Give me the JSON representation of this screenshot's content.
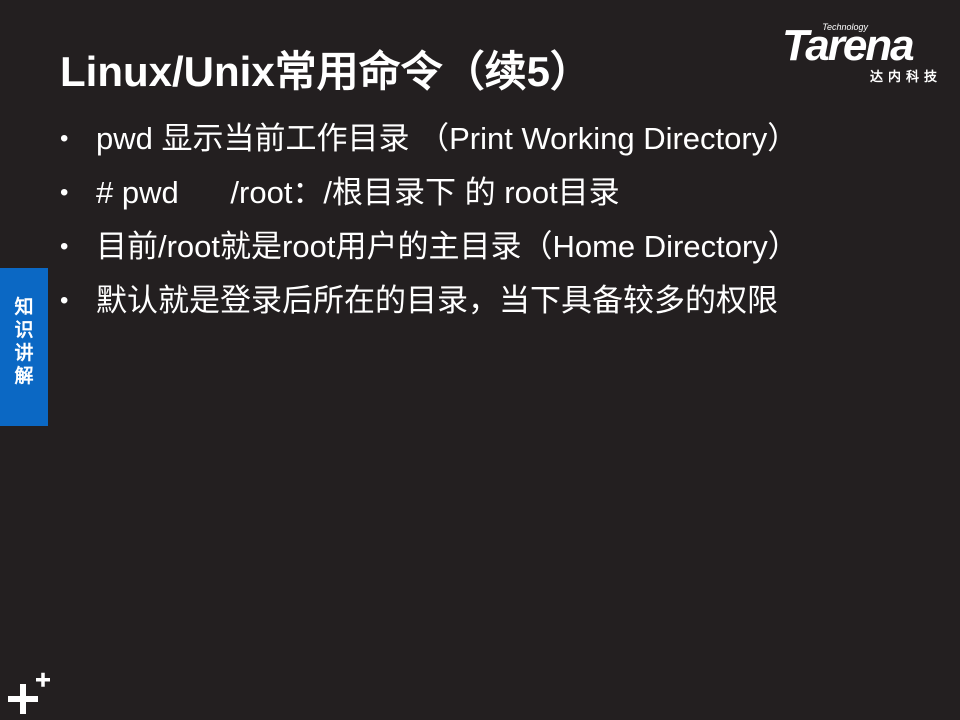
{
  "slide": {
    "title": "Linux/Unix常用命令（续5）",
    "bullets": [
      "pwd 显示当前工作目录 （Print Working Directory）",
      "# pwd      /root：/根目录下 的 root目录",
      "目前/root就是root用户的主目录（Home Directory）",
      "默认就是登录后所在的目录，当下具备较多的权限"
    ],
    "bullet_marker": "•"
  },
  "logo": {
    "tagline": "Technology",
    "word": "Tarena",
    "chinese": "达内科技"
  },
  "side_tab": {
    "label": "知识讲解",
    "color": "#0b68c4"
  },
  "theme": {
    "background": "#231f20",
    "text": "#ffffff"
  },
  "decorations": {
    "corner_icon": "plus-mark-icon"
  }
}
